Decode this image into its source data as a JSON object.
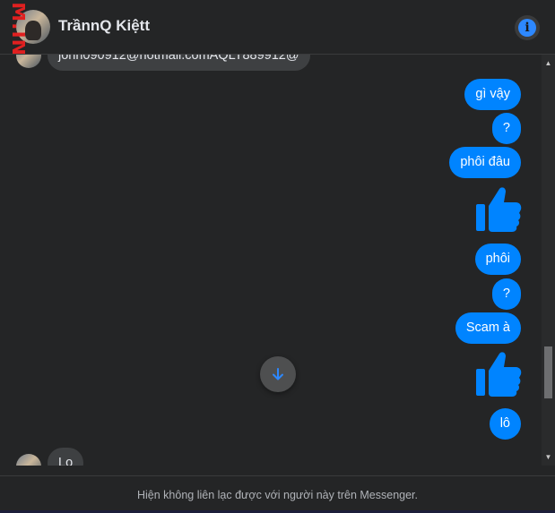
{
  "header": {
    "contact_name": "TrầnnQ Kiệtt",
    "info_icon": "info-icon",
    "info_glyph": "i"
  },
  "watermark": {
    "text": "M.INFO"
  },
  "messages": {
    "partial_received": "john090912@hotmail.comAQLT889912@",
    "sent": [
      "gì vậy",
      "?",
      "phôi đâu",
      "phôi",
      "?",
      "Scam à",
      "lô"
    ],
    "bottom_received": "Lo"
  },
  "footer": {
    "notice": "Hiện không liên lạc được với người này trên Messenger."
  },
  "colors": {
    "accent": "#0084ff",
    "background": "#242526"
  }
}
